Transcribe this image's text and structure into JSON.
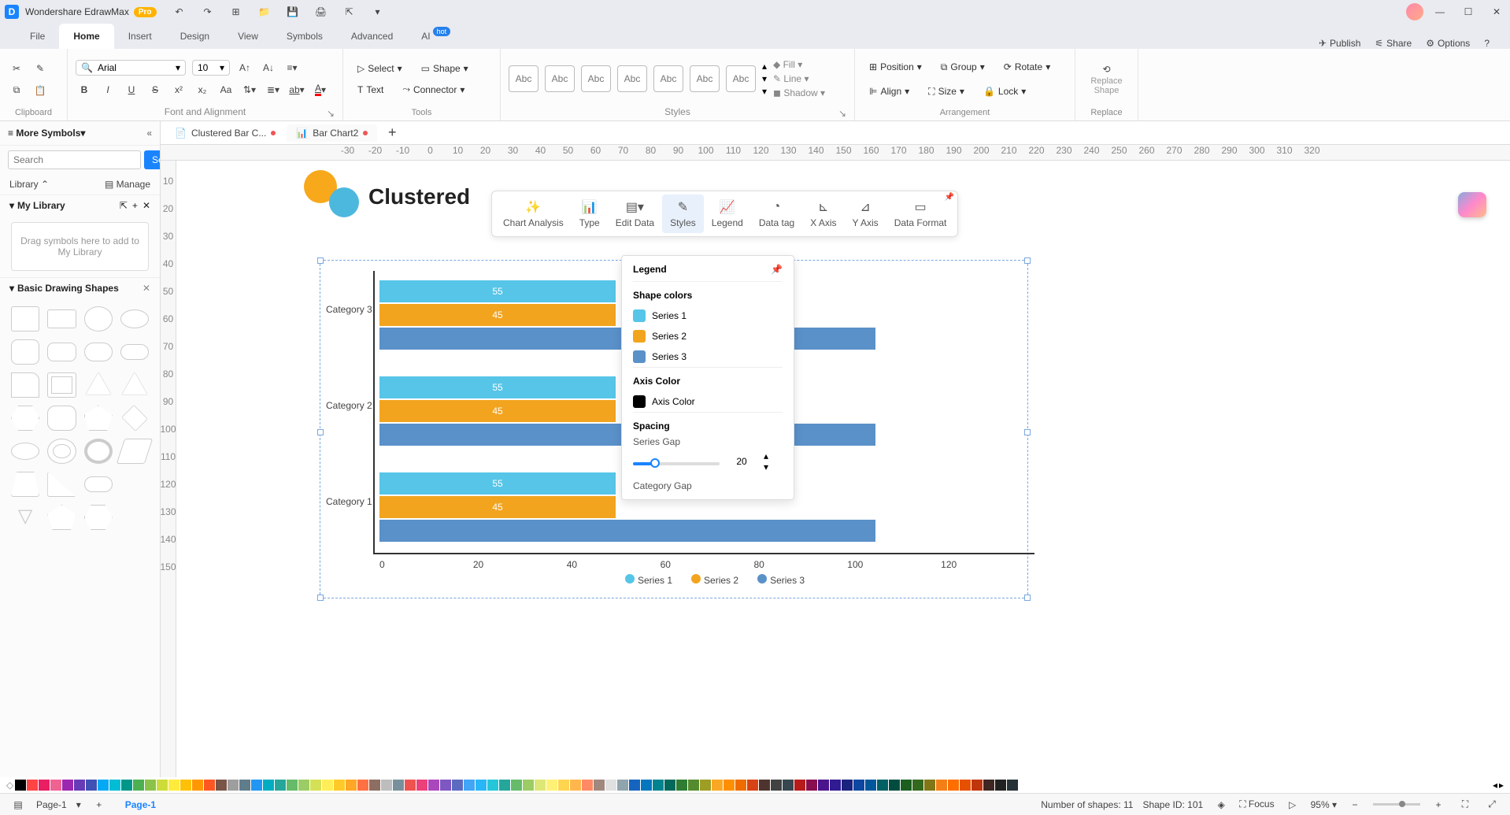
{
  "app": {
    "name": "Wondershare EdrawMax",
    "badge": "Pro"
  },
  "menus": {
    "file": "File",
    "home": "Home",
    "insert": "Insert",
    "design": "Design",
    "view": "View",
    "symbols": "Symbols",
    "advanced": "Advanced",
    "ai": "AI",
    "hot": "hot"
  },
  "topright": {
    "publish": "Publish",
    "share": "Share",
    "options": "Options"
  },
  "ribbon": {
    "clipboard": "Clipboard",
    "fontalign": "Font and Alignment",
    "tools": "Tools",
    "styles": "Styles",
    "arrangement": "Arrangement",
    "replace": "Replace",
    "font": "Arial",
    "size": "10",
    "select": "Select",
    "shape": "Shape",
    "text": "Text",
    "connector": "Connector",
    "abc": "Abc",
    "fill": "Fill",
    "line": "Line",
    "shadow": "Shadow",
    "position": "Position",
    "group": "Group",
    "rotate": "Rotate",
    "align": "Align",
    "sizet": "Size",
    "lock": "Lock",
    "replaceshape": "Replace Shape"
  },
  "tabs": {
    "t1": "Clustered Bar C...",
    "t2": "Bar Chart2"
  },
  "side": {
    "more": "More Symbols",
    "search_ph": "Search",
    "search_btn": "Search",
    "library": "Library",
    "manage": "Manage",
    "mylib": "My Library",
    "drop": "Drag symbols here to add to My Library",
    "basic": "Basic Drawing Shapes"
  },
  "chart_data": {
    "type": "bar",
    "title": "Clustered",
    "orientation": "horizontal",
    "categories": [
      "Category 1",
      "Category 2",
      "Category 3"
    ],
    "series": [
      {
        "name": "Series 1",
        "values": [
          55,
          55,
          55
        ],
        "color": "#56c5e8"
      },
      {
        "name": "Series 2",
        "values": [
          45,
          45,
          45
        ],
        "color": "#f2a41f"
      },
      {
        "name": "Series 3",
        "values": [
          95,
          95,
          95
        ],
        "color": "#5a91c9"
      }
    ],
    "xlim": [
      0,
      120
    ],
    "xticks": [
      0,
      20,
      40,
      60,
      80,
      100,
      120
    ]
  },
  "floatbar": {
    "analysis": "Chart Analysis",
    "type": "Type",
    "edit": "Edit Data",
    "styles": "Styles",
    "legend": "Legend",
    "datatag": "Data tag",
    "xaxis": "X Axis",
    "yaxis": "Y Axis",
    "format": "Data Format"
  },
  "panel": {
    "legend": "Legend",
    "shapecolors": "Shape colors",
    "s1": "Series 1",
    "s2": "Series 2",
    "s3": "Series 3",
    "axiscolor": "Axis Color",
    "axiscolor2": "Axis Color",
    "spacing": "Spacing",
    "seriesgap": "Series Gap",
    "seriesgapval": "20",
    "catgap": "Category Gap"
  },
  "status": {
    "page": "Page-1",
    "pagetab": "Page-1",
    "numshapes": "Number of shapes: 11",
    "shapeid": "Shape ID: 101",
    "focus": "Focus",
    "zoom": "95%"
  },
  "ruler_h": [
    "-30",
    "-20",
    "-10",
    "0",
    "10",
    "20",
    "30",
    "40",
    "50",
    "60",
    "70",
    "80",
    "90",
    "100",
    "110",
    "120",
    "130",
    "140",
    "150",
    "160",
    "170",
    "180",
    "190",
    "200",
    "210",
    "220",
    "230",
    "240",
    "250",
    "260",
    "270",
    "280",
    "290",
    "300",
    "310",
    "320"
  ],
  "ruler_v": [
    "10",
    "20",
    "30",
    "40",
    "50",
    "60",
    "70",
    "80",
    "90",
    "100",
    "110",
    "120",
    "130",
    "140",
    "150"
  ],
  "colors": [
    "#000",
    "#f44",
    "#e91e63",
    "#f06292",
    "#9c27b0",
    "#673ab7",
    "#3f51b5",
    "#03a9f4",
    "#00bcd4",
    "#009688",
    "#4caf50",
    "#8bc34a",
    "#cddc39",
    "#ffeb3b",
    "#ffc107",
    "#ff9800",
    "#ff5722",
    "#795548",
    "#9e9e9e",
    "#607d8b",
    "#2196f3",
    "#00acc1",
    "#26a69a",
    "#66bb6a",
    "#9ccc65",
    "#d4e157",
    "#ffee58",
    "#ffca28",
    "#ffa726",
    "#ff7043",
    "#8d6e63",
    "#bdbdbd",
    "#78909c",
    "#ef5350",
    "#ec407a",
    "#ab47bc",
    "#7e57c2",
    "#5c6bc0",
    "#42a5f5",
    "#29b6f6",
    "#26c6da",
    "#26a69a",
    "#66bb6a",
    "#9ccc65",
    "#dce775",
    "#fff176",
    "#ffd54f",
    "#ffb74d",
    "#ff8a65",
    "#a1887f",
    "#e0e0e0",
    "#90a4ae",
    "#1565c0",
    "#0277bd",
    "#00838f",
    "#00695c",
    "#2e7d32",
    "#558b2f",
    "#9e9d24",
    "#f9a825",
    "#ff8f00",
    "#ef6c00",
    "#d84315",
    "#4e342e",
    "#424242",
    "#37474f",
    "#b71c1c",
    "#880e4f",
    "#4a148c",
    "#311b92",
    "#1a237e",
    "#0d47a1",
    "#01579b",
    "#006064",
    "#004d40",
    "#1b5e20",
    "#33691e",
    "#827717",
    "#f57f17",
    "#ff6f00",
    "#e65100",
    "#bf360c",
    "#3e2723",
    "#212121",
    "#263238"
  ]
}
